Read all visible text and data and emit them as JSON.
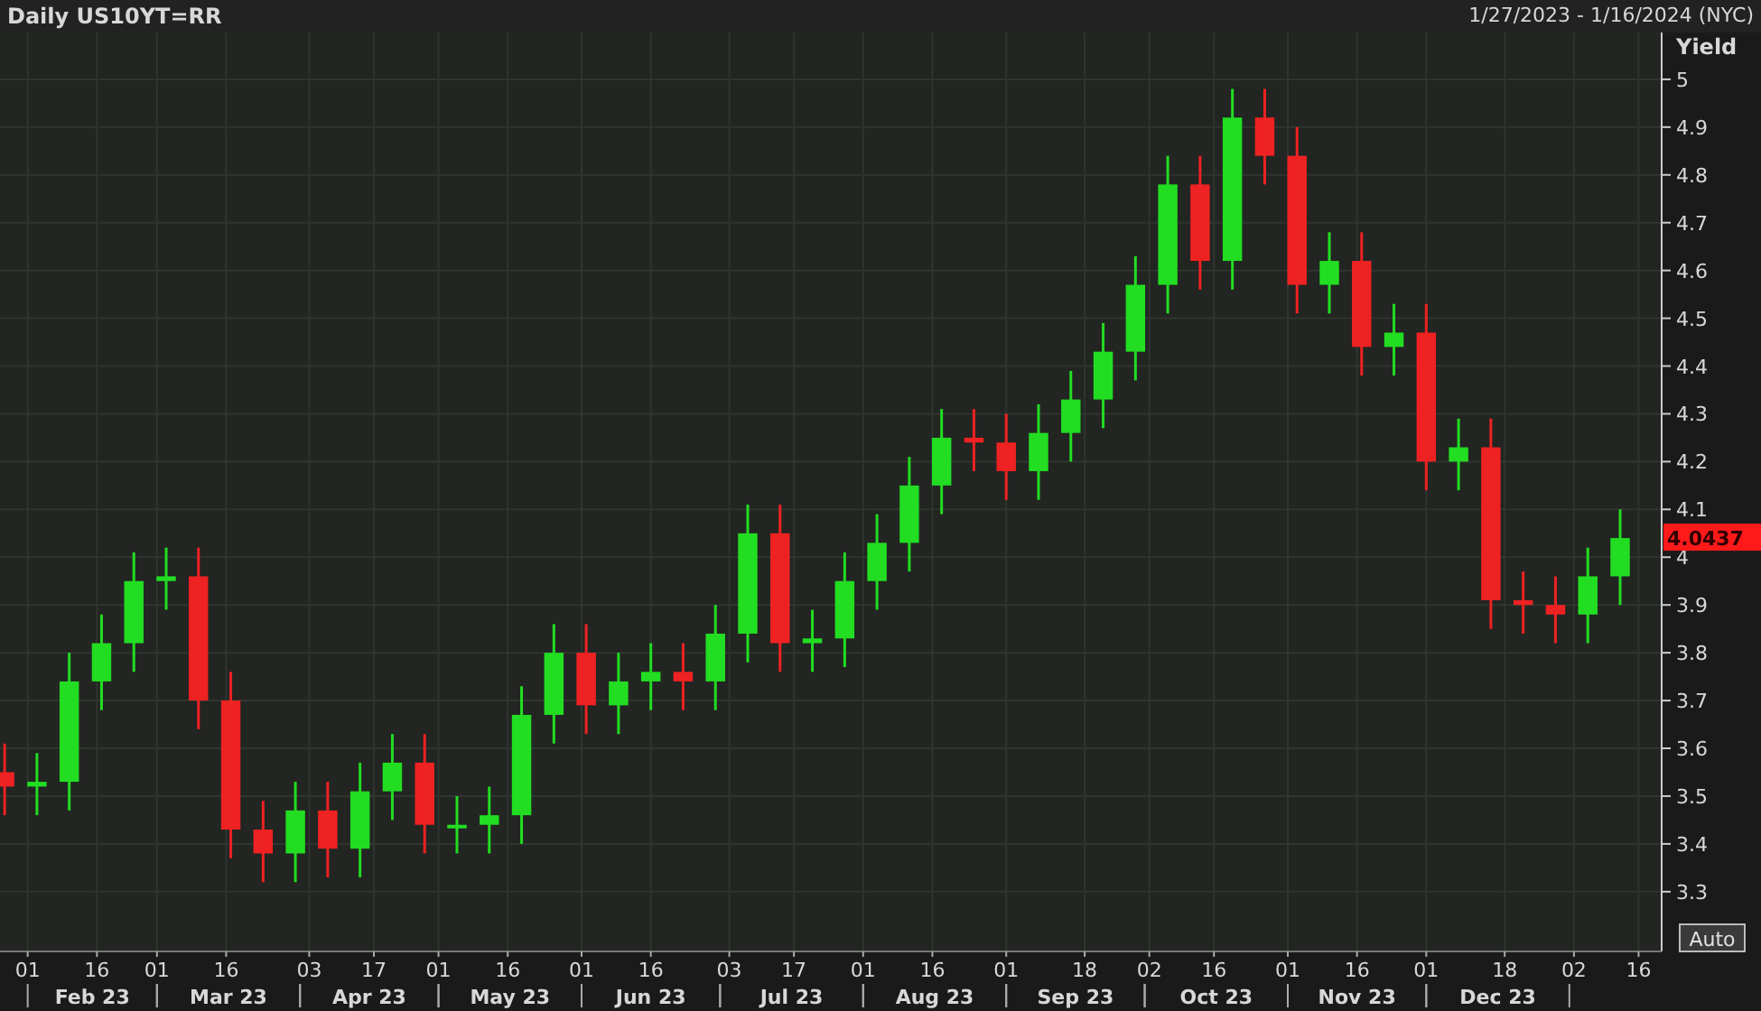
{
  "header": {
    "title": "Daily US10YT=RR",
    "range": "1/27/2023 - 1/16/2024 (NYC)"
  },
  "chart": {
    "last_price_label": "4.0437",
    "auto_button": "Auto",
    "month_labels": [
      "Feb 23",
      "Mar 23",
      "Apr 23",
      "May 23",
      "Jun 23",
      "Jul 23",
      "Aug 23",
      "Sep 23",
      "Oct 23",
      "Nov 23",
      "Dec 23"
    ],
    "chart_data": {
      "type": "candlestick",
      "grid": true,
      "ylabel": "Yield",
      "xlim": [
        "2023-01-26",
        "2024-01-21"
      ],
      "ylim": [
        3.175,
        5.098
      ],
      "x": [
        "2023-01-27",
        "2023-02-03",
        "2023-02-10",
        "2023-02-17",
        "2023-02-24",
        "2023-03-03",
        "2023-03-10",
        "2023-03-17",
        "2023-03-24",
        "2023-03-31",
        "2023-04-07",
        "2023-04-14",
        "2023-04-21",
        "2023-04-28",
        "2023-05-05",
        "2023-05-12",
        "2023-05-19",
        "2023-05-26",
        "2023-06-02",
        "2023-06-09",
        "2023-06-16",
        "2023-06-23",
        "2023-06-30",
        "2023-07-07",
        "2023-07-14",
        "2023-07-21",
        "2023-07-28",
        "2023-08-04",
        "2023-08-11",
        "2023-08-18",
        "2023-08-25",
        "2023-09-01",
        "2023-09-08",
        "2023-09-15",
        "2023-09-22",
        "2023-09-29",
        "2023-10-06",
        "2023-10-13",
        "2023-10-20",
        "2023-10-27",
        "2023-11-03",
        "2023-11-10",
        "2023-11-17",
        "2023-11-24",
        "2023-12-01",
        "2023-12-08",
        "2023-12-15",
        "2023-12-22",
        "2023-12-29",
        "2024-01-05",
        "2024-01-12"
      ],
      "ohlc": [
        [
          3.55,
          3.61,
          3.46,
          3.52
        ],
        [
          3.52,
          3.59,
          3.46,
          3.53
        ],
        [
          3.53,
          3.8,
          3.47,
          3.74
        ],
        [
          3.74,
          3.88,
          3.68,
          3.82
        ],
        [
          3.82,
          4.01,
          3.76,
          3.95
        ],
        [
          3.95,
          4.02,
          3.89,
          3.96
        ],
        [
          3.96,
          4.02,
          3.64,
          3.7
        ],
        [
          3.7,
          3.76,
          3.37,
          3.43
        ],
        [
          3.43,
          3.49,
          3.32,
          3.38
        ],
        [
          3.38,
          3.53,
          3.32,
          3.47
        ],
        [
          3.47,
          3.53,
          3.33,
          3.39
        ],
        [
          3.39,
          3.57,
          3.33,
          3.51
        ],
        [
          3.51,
          3.63,
          3.45,
          3.57
        ],
        [
          3.57,
          3.63,
          3.38,
          3.44
        ],
        [
          3.44,
          3.5,
          3.38,
          3.44
        ],
        [
          3.44,
          3.52,
          3.38,
          3.46
        ],
        [
          3.46,
          3.73,
          3.4,
          3.67
        ],
        [
          3.67,
          3.86,
          3.61,
          3.8
        ],
        [
          3.8,
          3.86,
          3.63,
          3.69
        ],
        [
          3.69,
          3.8,
          3.63,
          3.74
        ],
        [
          3.74,
          3.82,
          3.68,
          3.76
        ],
        [
          3.76,
          3.82,
          3.68,
          3.74
        ],
        [
          3.74,
          3.9,
          3.68,
          3.84
        ],
        [
          3.84,
          4.11,
          3.78,
          4.05
        ],
        [
          4.05,
          4.11,
          3.76,
          3.82
        ],
        [
          3.82,
          3.89,
          3.76,
          3.83
        ],
        [
          3.83,
          4.01,
          3.77,
          3.95
        ],
        [
          3.95,
          4.09,
          3.89,
          4.03
        ],
        [
          4.03,
          4.21,
          3.97,
          4.15
        ],
        [
          4.15,
          4.31,
          4.09,
          4.25
        ],
        [
          4.25,
          4.31,
          4.18,
          4.24
        ],
        [
          4.24,
          4.3,
          4.12,
          4.18
        ],
        [
          4.18,
          4.32,
          4.12,
          4.26
        ],
        [
          4.26,
          4.39,
          4.2,
          4.33
        ],
        [
          4.33,
          4.49,
          4.27,
          4.43
        ],
        [
          4.43,
          4.63,
          4.37,
          4.57
        ],
        [
          4.57,
          4.84,
          4.51,
          4.78
        ],
        [
          4.78,
          4.84,
          4.56,
          4.62
        ],
        [
          4.62,
          4.98,
          4.56,
          4.92
        ],
        [
          4.92,
          4.98,
          4.78,
          4.84
        ],
        [
          4.84,
          4.9,
          4.51,
          4.57
        ],
        [
          4.57,
          4.68,
          4.51,
          4.62
        ],
        [
          4.62,
          4.68,
          4.38,
          4.44
        ],
        [
          4.44,
          4.53,
          4.38,
          4.47
        ],
        [
          4.47,
          4.53,
          4.14,
          4.2
        ],
        [
          4.2,
          4.29,
          4.14,
          4.23
        ],
        [
          4.23,
          4.29,
          3.85,
          3.91
        ],
        [
          3.91,
          3.97,
          3.84,
          3.9
        ],
        [
          3.9,
          3.96,
          3.82,
          3.88
        ],
        [
          3.88,
          4.02,
          3.82,
          3.96
        ],
        [
          3.96,
          4.1,
          3.9,
          4.04
        ]
      ],
      "yticks": [
        3.3,
        3.4,
        3.5,
        3.6,
        3.7,
        3.8,
        3.9,
        {
          "value": 4,
          "label": "4"
        },
        4.1,
        4.2,
        4.3,
        4.4,
        4.5,
        4.6,
        4.7,
        4.8,
        4.9,
        {
          "value": 5,
          "label": "5"
        }
      ],
      "xticks": [
        {
          "value": "2023-02-01",
          "label": "01"
        },
        {
          "value": "2023-02-16",
          "label": "16"
        },
        {
          "value": "2023-03-01",
          "label": "01"
        },
        {
          "value": "2023-03-16",
          "label": "16"
        },
        {
          "value": "2023-04-03",
          "label": "03"
        },
        {
          "value": "2023-04-17",
          "label": "17"
        },
        {
          "value": "2023-05-01",
          "label": "01"
        },
        {
          "value": "2023-05-16",
          "label": "16"
        },
        {
          "value": "2023-06-01",
          "label": "01"
        },
        {
          "value": "2023-06-16",
          "label": "16"
        },
        {
          "value": "2023-07-03",
          "label": "03"
        },
        {
          "value": "2023-07-17",
          "label": "17"
        },
        {
          "value": "2023-08-01",
          "label": "01"
        },
        {
          "value": "2023-08-16",
          "label": "16"
        },
        {
          "value": "2023-09-01",
          "label": "01"
        },
        {
          "value": "2023-09-18",
          "label": "18"
        },
        {
          "value": "2023-10-02",
          "label": "02"
        },
        {
          "value": "2023-10-16",
          "label": "16"
        },
        {
          "value": "2023-11-01",
          "label": "01"
        },
        {
          "value": "2023-11-16",
          "label": "16"
        },
        {
          "value": "2023-12-01",
          "label": "01"
        },
        {
          "value": "2023-12-18",
          "label": "18"
        },
        {
          "value": "2024-01-02",
          "label": "02"
        },
        {
          "value": "2024-01-16",
          "label": "16"
        }
      ]
    }
  }
}
